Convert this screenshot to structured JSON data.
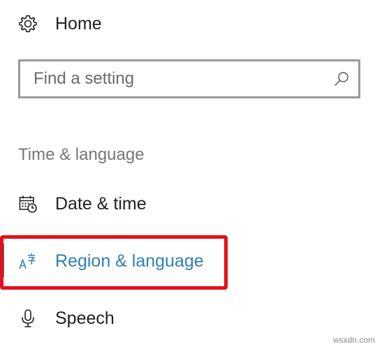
{
  "nav": {
    "home": {
      "label": "Home",
      "icon": "gear-icon"
    },
    "date_time": {
      "label": "Date & time",
      "icon": "calendar-clock-icon"
    },
    "region_language": {
      "label": "Region & language",
      "icon": "region-language-icon",
      "selected": true
    },
    "speech": {
      "label": "Speech",
      "icon": "microphone-icon"
    }
  },
  "search": {
    "placeholder": "Find a setting",
    "value": ""
  },
  "section": {
    "heading": "Time & language"
  },
  "colors": {
    "accent": "#2f7fb3",
    "highlight_border": "#e3101b",
    "search_border": "#9a9a9a",
    "heading_text": "#767676"
  },
  "watermark": "wsxdn.com"
}
